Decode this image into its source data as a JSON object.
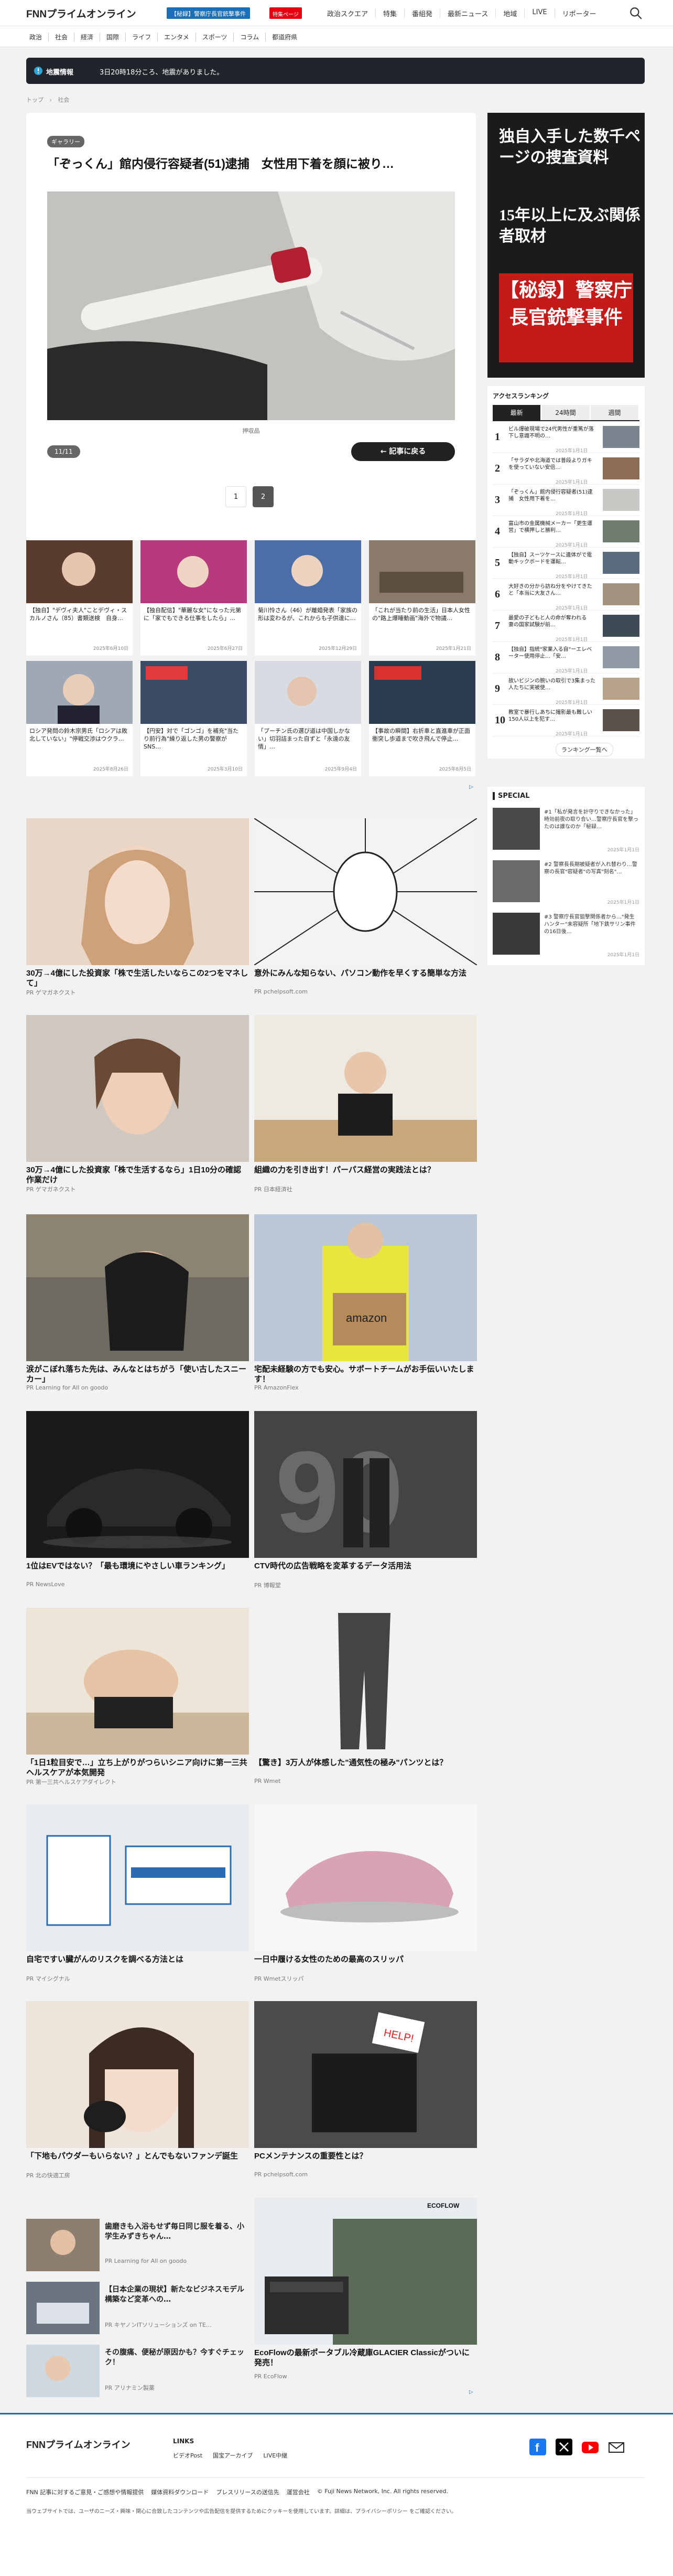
{
  "header": {
    "logo": "FNNプライムオンライン",
    "promo": "【秘録】警察庁長官銃撃事件",
    "promo_badge": "特集ページ",
    "nav": [
      "政治スクエア",
      "特集",
      "番組発",
      "最新ニュース",
      "地域",
      "LIVE",
      "リポーター"
    ]
  },
  "categories": [
    "政治",
    "社会",
    "経済",
    "国際",
    "ライフ",
    "エンタメ",
    "スポーツ",
    "コラム",
    "都道府県"
  ],
  "alert": {
    "label": "地震情報",
    "message": "3日20時18分ころ、地震がありました。"
  },
  "breadcrumb": [
    "トップ",
    "›",
    "社会"
  ],
  "article": {
    "tag": "ギャラリー",
    "title": "「ぞっくん」館内侵行容疑者(51)逮捕　女性用下着を顔に被り…",
    "caption": "押収品",
    "counter": "11/11",
    "back_label": "記事に戻る",
    "pages": [
      "1",
      "2"
    ]
  },
  "related": [
    {
      "title": "【独自】\"デヴィ夫人\"ことデヴィ・スカルノさん（85）書類送検　自身…",
      "date": "2025年6月10日"
    },
    {
      "title": "【独自配信】\"華麗な女\"になった元第に「家でもできる仕事をしたら」…",
      "date": "2025年6月27日"
    },
    {
      "title": "菊川怜さん（46）が離婚発表「家族の形は変わるが、これからも子供達に…",
      "date": "2025年12月29日"
    },
    {
      "title": "「これが当たり前の生活」日本人女性の\"路上爆睡動画\"海外で物議…",
      "date": "2025年1月21日"
    },
    {
      "title": "ロシア発問の鈴木宗男氏「ロシアは敗北していない」\"停戦交渉はウクラ…",
      "date": "2025年8月26日"
    },
    {
      "title": "【円安】対で「ゴンゴ」を補充\"当たり前行為\"繰り返した男の警察がSNS…",
      "date": "2025年3月10日"
    },
    {
      "title": "「プーチン氏の選び道は中国しかない」切羽詰まった自ずと「永遠の友情」…",
      "date": "2025年9月4日"
    },
    {
      "title": "【事故の瞬間】右折車と直進車が正面衝突し歩道まで吹き飛んで停止…",
      "date": "2025年8月5日"
    }
  ],
  "side_ad": {
    "line1": "独自入手した数千ページの捜査資料",
    "line2": "15年以上に及ぶ関係者取材",
    "line3": "【秘録】警察庁長官銃撃事件"
  },
  "ranking": {
    "title": "アクセスランキング",
    "tabs": [
      "最新",
      "24時間",
      "週間"
    ],
    "items": [
      {
        "n": "1",
        "title": "ビル爆破現場で24代男性が重篤が落下し意識不明の…",
        "date": "2025年1月1日"
      },
      {
        "n": "2",
        "title": "「サラダや北海道では普段よりガキを使っていない安倍…",
        "date": "2025年1月1日"
      },
      {
        "n": "3",
        "title": "「ぞっくん」館内侵行容疑者(51)逮捕　女性用下着を…",
        "date": "2025年1月1日"
      },
      {
        "n": "4",
        "title": "富山市の金属機械メーカー「更生運営」で横押しと勝利…",
        "date": "2025年1月1日"
      },
      {
        "n": "5",
        "title": "【独自】スーツケースに遺体がで電動キックボードを運転…",
        "date": "2025年1月1日"
      },
      {
        "n": "6",
        "title": "大好きの分から訪ね分をやけてきたと「本当に大友さん…",
        "date": "2025年1月1日"
      },
      {
        "n": "7",
        "title": "最愛の子どもと人の命が奪われる　妻の国家試験が前…",
        "date": "2025年1月1日"
      },
      {
        "n": "8",
        "title": "【独自】指統\"家業入る自\"ーエレベーター使用停止…「安…",
        "date": "2025年1月1日"
      },
      {
        "n": "9",
        "title": "故いビジンの腕いの取引で3集まった人たちに実被使…",
        "date": "2025年1月1日"
      },
      {
        "n": "10",
        "title": "教室で暴行しあちに撮影最も難しい150人以上を犯す…",
        "date": "2025年1月1日"
      }
    ],
    "more": "ランキング一覧へ"
  },
  "special": {
    "title": "SPECIAL",
    "items": [
      {
        "title": "#1「私が発言を計守りできなかった」時効前夜の取り合い…警察庁長官を撃ったのは誰なのか「秘録…",
        "date": "2025年1月1日"
      },
      {
        "title": "#2 警察長長期被疑者が入れ替わり…警察の長官\"容疑者\"の写真\"刻名\"…",
        "date": "2025年1月1日"
      },
      {
        "title": "#3 警察庁長官狙撃関係者から…\"発生ハンター\"未容疑所「地下鉄サリン事件の16日後…",
        "date": "2025年1月1日"
      }
    ]
  },
  "ads": [
    {
      "title": "30万→4億にした投資家「株で生活したいならこの2つをマネして」",
      "source": "PR ゲマガネクスト"
    },
    {
      "title": "意外にみんな知らない、パソコン動作を早くする簡単な方法",
      "source": "PR pchelpsoft.com"
    },
    {
      "title": "30万→4億にした投資家「株で生活するなら」1日10分の確認作業だけ",
      "source": "PR ゲマガネクスト"
    },
    {
      "title": "組織の力を引き出す！パーパス経営の実践法とは？",
      "source": "PR 日本経済社"
    },
    {
      "title": "涙がこぼれ落ちた先は、みんなとはちがう「使い古したスニーカー」",
      "source": "PR Learning for All on goodo"
    },
    {
      "title": "宅配未経験の方でも安心。サポートチームがお手伝いいたします！",
      "source": "PR AmazonFlex"
    },
    {
      "title": "1位はEVではない？「最も環境にやさしい車ランキング」",
      "source": "PR NewsLove"
    },
    {
      "title": "CTV時代の広告戦略を変革するデータ活用法",
      "source": "PR 博報堂"
    },
    {
      "title": "「1日1粒目安で…」立ち上がりがつらいシニア向けに第一三共ヘルスケアが本気開発",
      "source": "PR 第一三共ヘルスケアダイレクト"
    },
    {
      "title": "【驚き】3万人が体感した\"通気性の極み\"パンツとは？",
      "source": "PR Wmet"
    },
    {
      "title": "自宅ですい臓がんのリスクを調べる方法とは",
      "source": "PR マイシグナル"
    },
    {
      "title": "一日中履ける女性のための最高のスリッパ",
      "source": "PR Wmetスリッパ"
    },
    {
      "title": "「下地もパウダーもいらない？」とんでもないファンデ誕生",
      "source": "PR 北の快適工房"
    },
    {
      "title": "PCメンテナンスの重要性とは？",
      "source": "PR pchelpsoft.com"
    }
  ],
  "small_ads": [
    {
      "title": "歯磨きも入浴もせず毎日同じ服を着る、小学生みずきちゃん…",
      "source": "PR Learning for All on goodo"
    },
    {
      "title": "【日本企業の現状】新たなビジネスモデル構築など変革への…",
      "source": "PR キヤノンITソリューションズ on TE…"
    },
    {
      "title": "その腹痛、便秘が原因かも？今すぐチェック！",
      "source": "PR アリナミン製薬"
    }
  ],
  "ecoflow": {
    "title": "EcoFlowの最新ポータブル冷蔵庫GLACIER Classicがついに発売！",
    "source": "PR EcoFlow",
    "brand": "ECOFLOW"
  },
  "footer": {
    "logo": "FNNプライムオンライン",
    "links_title": "LINKS",
    "links": [
      "ビデオPost",
      "国宝アーカイブ",
      "LIVE中継"
    ],
    "legal": [
      "FNN 記事に対するご意見・ご感想や情報提供",
      "媒体資料ダウンロード",
      "プレスリリースの送信先",
      "運営会社",
      "© Fuji News Network, Inc. All rights reserved."
    ],
    "note": "当ウェブサイトでは、ユーザのニーズ・興味・関心に合致したコンテンツや広告配信を提供するためにクッキーを使用しています。詳細は、プライバシーポリシー をご確認ください。"
  }
}
